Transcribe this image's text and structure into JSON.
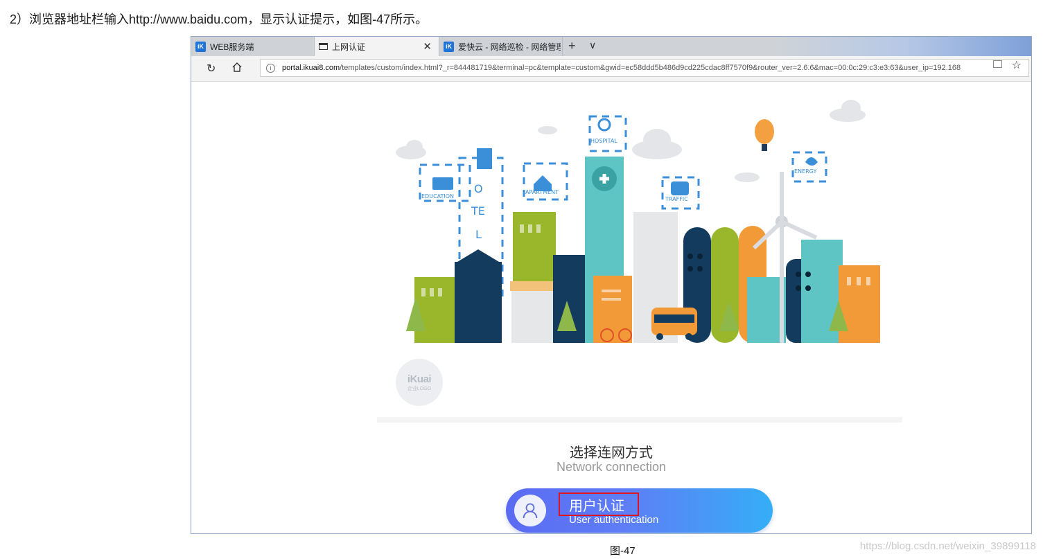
{
  "document": {
    "step_text": "2）浏览器地址栏输入http://www.baidu.com，显示认证提示，如图-47所示。",
    "caption": "图-47",
    "watermark": "https://blog.csdn.net/weixin_39899118"
  },
  "browser": {
    "tabs": [
      {
        "label": "WEB服务端",
        "icon": "ikuai-icon"
      },
      {
        "label": "上网认证",
        "icon": "page-icon",
        "active": true
      },
      {
        "label": "爱快云 - 网络巡检 - 网络管理",
        "icon": "ikuai-icon"
      }
    ],
    "new_tab": "+",
    "tab_menu": "∨",
    "address": {
      "host": "portal.ikuai8.com",
      "path": "/templates/custom/index.html?_r=844481719&terminal=pc&template=custom&gwid=ec58ddd5b486d9cd225cdac8ff7570f9&router_ver=2.6.6&mac=00:0c:29:c3:e3:63&user_ip=192.168"
    },
    "icons": {
      "refresh": "refresh-icon",
      "home": "home-icon",
      "reader": "reader-view-icon",
      "favorite": "star-icon"
    }
  },
  "portal": {
    "illustration_labels": {
      "education": "EDUCATION",
      "hotel": [
        "H",
        "O",
        "TE",
        "L"
      ],
      "apartment": "APARTMENT",
      "hospital": "HOSPITAL",
      "traffic": "TRAFFIC",
      "energy": "ENERGY"
    },
    "logo": {
      "brand": "iKuai",
      "sub": "企业LOGO"
    },
    "section_title_cn": "选择连网方式",
    "section_title_en": "Network connection",
    "auth_button": {
      "label_cn": "用户认证",
      "label_en": "User authentication"
    },
    "colors": {
      "accent_start": "#5b6bf3",
      "accent_end": "#35aef6",
      "highlight_box": "#e0151d"
    }
  }
}
